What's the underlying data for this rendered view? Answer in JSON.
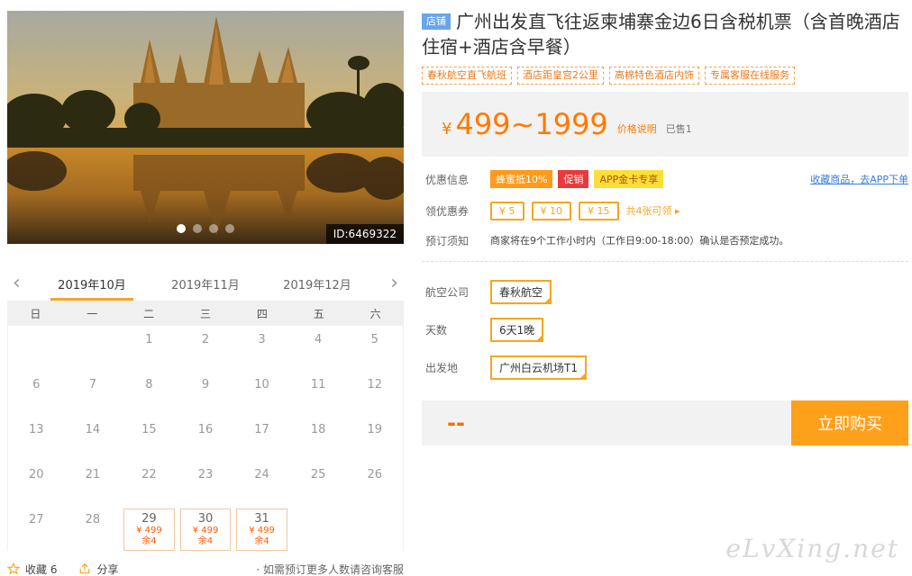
{
  "gallery": {
    "image_id": "ID:6469322",
    "dots": 4,
    "active_dot": 0
  },
  "calendar": {
    "prev_arrow": "‹",
    "next_arrow": "›",
    "months": [
      "2019年10月",
      "2019年11月",
      "2019年12月"
    ],
    "active_month": 0,
    "weekdays": [
      "日",
      "一",
      "二",
      "三",
      "四",
      "五",
      "六"
    ],
    "leading_blanks": 2,
    "days": [
      {
        "d": "1"
      },
      {
        "d": "2"
      },
      {
        "d": "3"
      },
      {
        "d": "4"
      },
      {
        "d": "5"
      },
      {
        "d": "6"
      },
      {
        "d": "7"
      },
      {
        "d": "8"
      },
      {
        "d": "9"
      },
      {
        "d": "10"
      },
      {
        "d": "11"
      },
      {
        "d": "12"
      },
      {
        "d": "13"
      },
      {
        "d": "14"
      },
      {
        "d": "15"
      },
      {
        "d": "16"
      },
      {
        "d": "17"
      },
      {
        "d": "18"
      },
      {
        "d": "19"
      },
      {
        "d": "20"
      },
      {
        "d": "21"
      },
      {
        "d": "22"
      },
      {
        "d": "23"
      },
      {
        "d": "24"
      },
      {
        "d": "25"
      },
      {
        "d": "26"
      },
      {
        "d": "27"
      },
      {
        "d": "28"
      },
      {
        "d": "29",
        "price": "¥ 499",
        "stock": "余4"
      },
      {
        "d": "30",
        "price": "¥ 499",
        "stock": "余4"
      },
      {
        "d": "31",
        "price": "¥ 499",
        "stock": "余4"
      }
    ]
  },
  "actions": {
    "favorite": "收藏 6",
    "share": "分享",
    "note": "· 如需预订更多人数请咨询客服"
  },
  "product": {
    "shop_tag": "店铺",
    "title": "广州出发直飞往返柬埔寨金边6日含税机票（含首晚酒店住宿+酒店含早餐）",
    "features": [
      "春秋航空直飞航班",
      "酒店距皇宫2公里",
      "高棉特色酒店内饰",
      "专属客服在线服务"
    ],
    "price_symbol": "¥",
    "price": "499~1999",
    "price_note": "价格说明",
    "sold": "已售1"
  },
  "promo": {
    "label": "优惠信息",
    "badges": [
      "蜂蜜抵10%",
      "促销",
      "APP金卡专享"
    ],
    "fav_link": "收藏商品，去APP下单"
  },
  "coupons": {
    "label": "领优惠券",
    "items": [
      "¥ 5",
      "¥ 10",
      "¥ 15"
    ],
    "more": "共4张可领 ▸"
  },
  "notice": {
    "label": "预订须知",
    "text": "商家将在9个工作小时内（工作日9:00-18:00）确认是否预定成功。"
  },
  "options": [
    {
      "label": "航空公司",
      "value": "春秋航空"
    },
    {
      "label": "天数",
      "value": "6天1晚"
    },
    {
      "label": "出发地",
      "value": "广州白云机场T1"
    }
  ],
  "buy": {
    "qty_placeholder": "--",
    "button": "立即购买"
  },
  "watermark": "eLvXing.net",
  "colors": {
    "accent": "#ffa01a",
    "price": "#ff7a00"
  }
}
